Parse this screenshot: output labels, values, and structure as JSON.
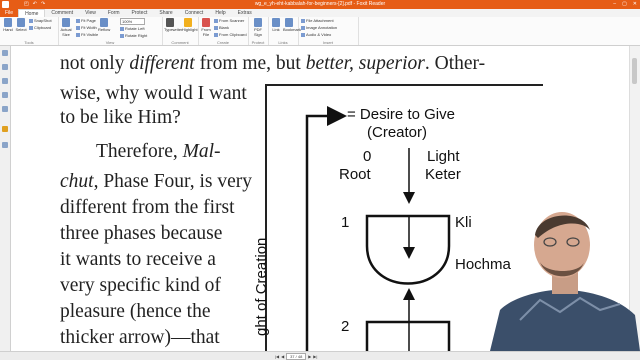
{
  "window": {
    "title": "wg_e_yh-eht-kabbalah-for-beginners-[2].pdf - Foxit Reader",
    "quick_access": [
      "◰",
      "↶",
      "↷"
    ],
    "controls": [
      "–",
      "▢",
      "✕"
    ]
  },
  "menu": {
    "file": "File",
    "tabs": [
      "Home",
      "Comment",
      "View",
      "Form",
      "Protect",
      "Share",
      "Connect",
      "Help",
      "Extras"
    ]
  },
  "ribbon": {
    "tools": {
      "hand": "Hand",
      "select": "Select",
      "snapshot": "SnapShot",
      "clipboard": "Clipboard",
      "label": "Tools"
    },
    "view": {
      "actual_size": "Actual Size",
      "fit_page": "Fit Page",
      "fit_width": "Fit Width",
      "fit_visible": "Fit Visible",
      "reflow": "Reflow",
      "zoom_value": "100%",
      "rotate_left": "Rotate Left",
      "rotate_right": "Rotate Right",
      "label": "View"
    },
    "comment": {
      "typewriter": "Typewriter",
      "highlight": "Highlight",
      "label": "Comment"
    },
    "create": {
      "from_file": "From File",
      "from_scanner": "From Scanner",
      "blank": "Blank",
      "from_clipboard": "From Clipboard",
      "label": "Create"
    },
    "protect": {
      "pdf_sign": "PDF Sign",
      "label": "Protect"
    },
    "links": {
      "link": "Link",
      "bookmark": "Bookmark",
      "label": "Links"
    },
    "insert": {
      "file_attachment": "File Attachment",
      "image_annotation": "Image Annotation",
      "audio_video": "Audio & Video",
      "label": "Insert"
    }
  },
  "document": {
    "body_lines": [
      {
        "parts": [
          {
            "t": "not only ",
            "i": false
          },
          {
            "t": "different",
            "i": true
          },
          {
            "t": " from me, but ",
            "i": false
          },
          {
            "t": "better, superior",
            "i": true
          },
          {
            "t": ". Other-",
            "i": false
          }
        ]
      },
      {
        "parts": [
          {
            "t": "wise, why would I want",
            "i": false
          }
        ]
      },
      {
        "parts": [
          {
            "t": "to be like Him?",
            "i": false
          }
        ]
      },
      {
        "parts": [
          {
            "t": "Therefore, ",
            "i": false
          },
          {
            "t": "Mal-",
            "i": true
          }
        ]
      },
      {
        "parts": [
          {
            "t": "chut",
            "i": true
          },
          {
            "t": ", Phase Four, is very",
            "i": false
          }
        ]
      },
      {
        "parts": [
          {
            "t": "different from the first",
            "i": false
          }
        ]
      },
      {
        "parts": [
          {
            "t": "three phases because",
            "i": false
          }
        ]
      },
      {
        "parts": [
          {
            "t": "it wants to receive a",
            "i": false
          }
        ]
      },
      {
        "parts": [
          {
            "t": "very specific kind of",
            "i": false
          }
        ]
      },
      {
        "parts": [
          {
            "t": "pleasure (hence the",
            "i": false
          }
        ]
      },
      {
        "parts": [
          {
            "t": "thicker arrow)—that",
            "i": false
          }
        ]
      }
    ],
    "diagram": {
      "desire_label": "= Desire to Give",
      "creator_label": "(Creator)",
      "root_num": "0",
      "root_label": "Root",
      "light_label": "Light",
      "keter_label": "Keter",
      "phase1_num": "1",
      "kli_label": "Kli",
      "hochma_label": "Hochma",
      "phase2_num": "2",
      "vertical_label": "ght of Creation"
    }
  },
  "statusbar": {
    "page_value": "37 / 48",
    "nav": [
      "|◀",
      "◀",
      "▶",
      "▶|"
    ]
  },
  "colors": {
    "brand": "#e65d16",
    "ribbon_bg": "#fbfbfb",
    "document_bg": "#ffffff"
  }
}
